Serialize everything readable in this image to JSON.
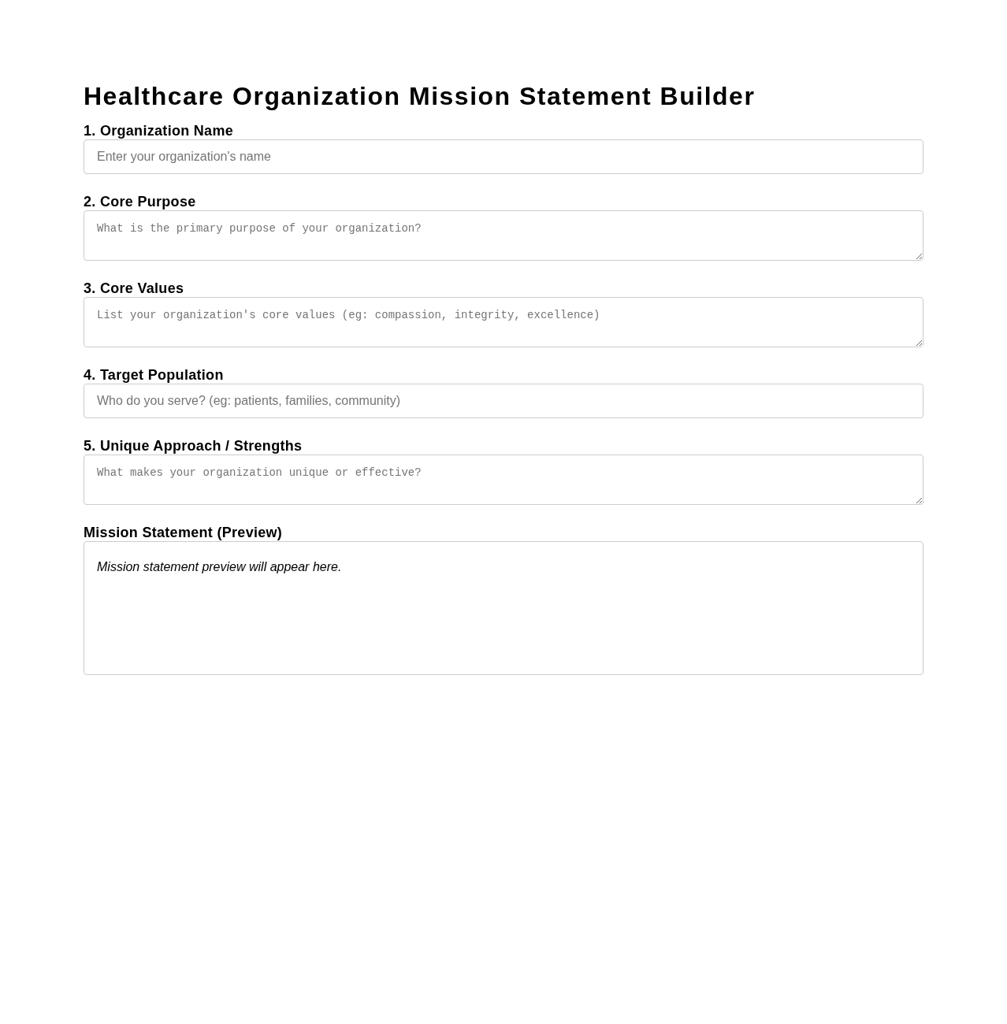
{
  "title": "Healthcare Organization Mission Statement Builder",
  "fields": [
    {
      "kind": "input",
      "label": "1. Organization Name",
      "placeholder": "Enter your organization's name"
    },
    {
      "kind": "textarea",
      "label": "2. Core Purpose",
      "placeholder": "What is the primary purpose of your organization?"
    },
    {
      "kind": "textarea",
      "label": "3. Core Values",
      "placeholder": "List your organization's core values (eg: compassion, integrity, excellence)"
    },
    {
      "kind": "input",
      "label": "4. Target Population",
      "placeholder": "Who do you serve? (eg: patients, families, community)"
    },
    {
      "kind": "textarea",
      "label": "5. Unique Approach / Strengths",
      "placeholder": "What makes your organization unique or effective?"
    }
  ],
  "preview": {
    "label": "Mission Statement (Preview)",
    "text": "Mission statement preview will appear here."
  }
}
